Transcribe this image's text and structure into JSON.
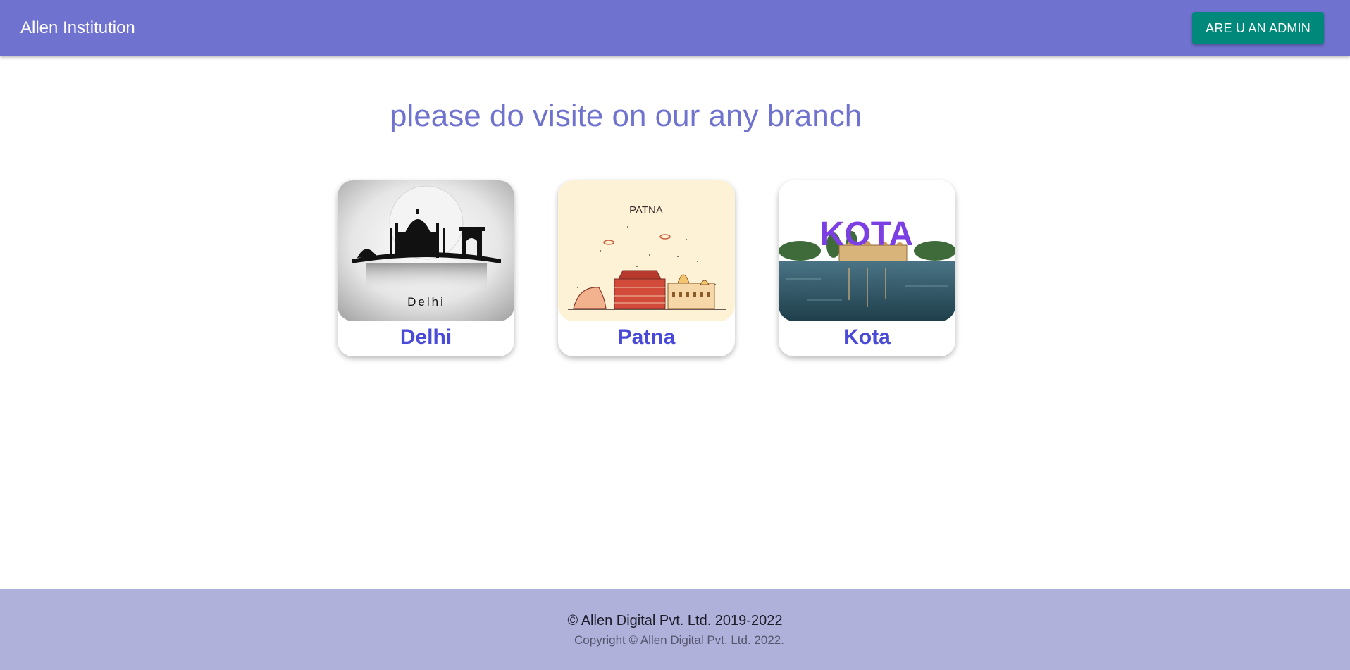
{
  "header": {
    "brand": "Allen Institution",
    "admin_button": "ARE U AN ADMIN"
  },
  "main": {
    "heading": "please do visite on our any branch",
    "branches": [
      {
        "name": "Delhi",
        "image_caption": "Delhi"
      },
      {
        "name": "Patna",
        "image_caption": "PATNA"
      },
      {
        "name": "Kota",
        "image_caption": "KOTA"
      }
    ]
  },
  "footer": {
    "copyright_line": "© Allen Digital Pvt. Ltd. 2019-2022",
    "copyright_prefix": "Copyright ©",
    "company_link": "Allen Digital Pvt. Ltd.",
    "copyright_suffix": "2022."
  },
  "colors": {
    "appbar": "#6f72cf",
    "admin_button": "#00897b",
    "card_label": "#4a4ad9",
    "footer": "#b0b1da"
  }
}
